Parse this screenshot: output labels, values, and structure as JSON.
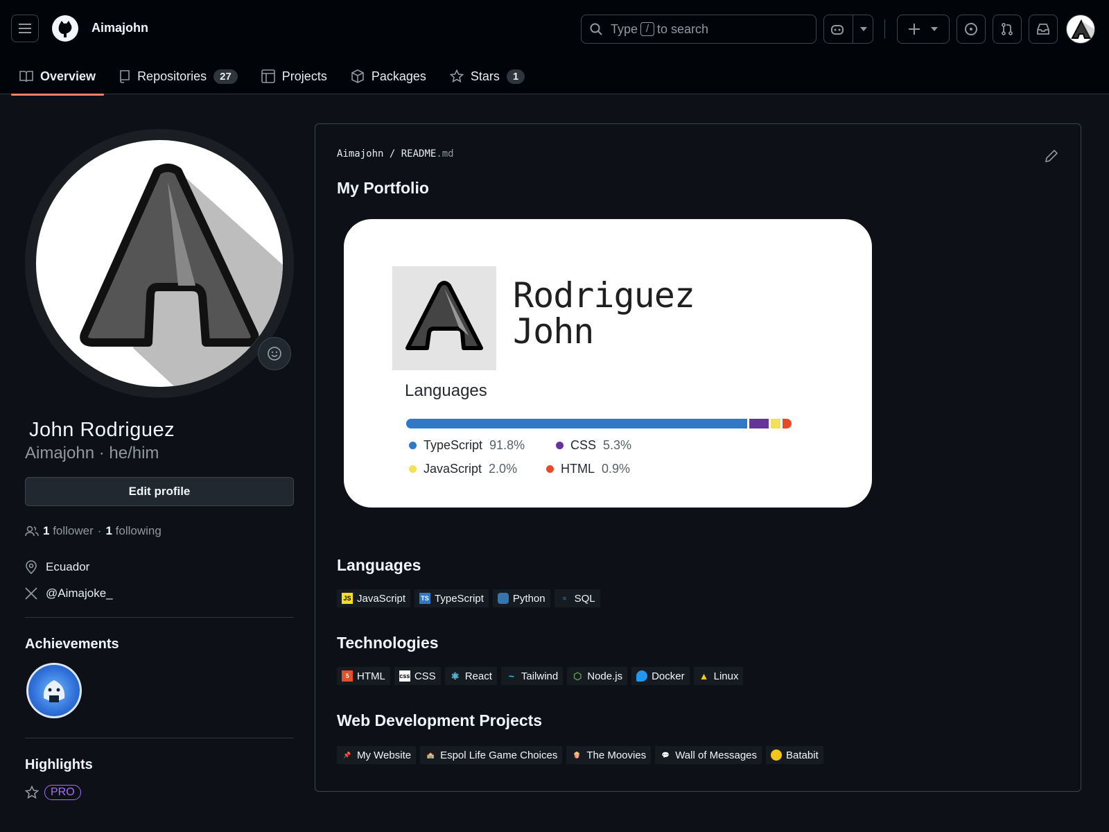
{
  "header": {
    "username": "Aimajohn",
    "search": {
      "prefix": "Type",
      "key": "/",
      "suffix": "to search"
    }
  },
  "tabs": [
    {
      "label": "Overview"
    },
    {
      "label": "Repositories",
      "count": "27"
    },
    {
      "label": "Projects"
    },
    {
      "label": "Packages"
    },
    {
      "label": "Stars",
      "count": "1"
    }
  ],
  "profile": {
    "full_name": "John Rodriguez",
    "handle_line": "Aimajohn · he/him",
    "edit_label": "Edit profile",
    "followers_count": "1",
    "followers_label": "follower",
    "following_count": "1",
    "following_label": "following",
    "location": "Ecuador",
    "twitter": "@Aimajoke_",
    "achievements_title": "Achievements",
    "highlights_title": "Highlights",
    "pro_label": "PRO"
  },
  "readme": {
    "owner": "Aimajohn",
    "sep": "/",
    "file": "README",
    "ext": ".md",
    "title": "My Portfolio",
    "card": {
      "name_line1": "Rodriguez",
      "name_line2": "John",
      "languages_title": "Languages",
      "languages": [
        {
          "name": "TypeScript",
          "pct": "91.8%",
          "value": 91.8,
          "color": "#3178c6"
        },
        {
          "name": "CSS",
          "pct": "5.3%",
          "value": 5.3,
          "color": "#663399"
        },
        {
          "name": "JavaScript",
          "pct": "2.0%",
          "value": 2.0,
          "color": "#f1e05a"
        },
        {
          "name": "HTML",
          "pct": "0.9%",
          "value": 0.9,
          "color": "#e34c26"
        }
      ]
    },
    "sections": {
      "languages_title": "Languages",
      "languages": [
        "JavaScript",
        "TypeScript",
        "Python",
        "SQL"
      ],
      "tech_title": "Technologies",
      "technologies": [
        "HTML",
        "CSS",
        "React",
        "Tailwind",
        "Node.js",
        "Docker",
        "Linux"
      ],
      "projects_title": "Web Development Projects",
      "projects": [
        "My Website",
        "Espol Life Game Choices",
        "The Moovies",
        "Wall of Messages",
        "Batabit"
      ]
    }
  }
}
